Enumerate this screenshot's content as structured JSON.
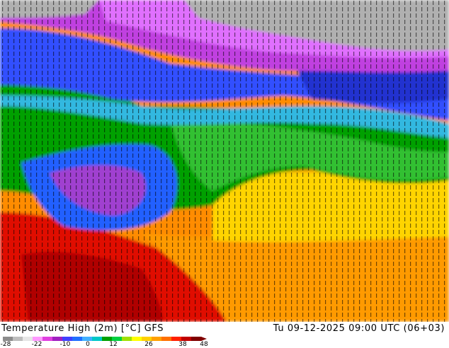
{
  "map": {
    "model": "GFS",
    "variable_title": "Temperature High (2m) [°C] GFS",
    "datetime": "Tu 09-12-2025 09:00 UTC (06+03)"
  },
  "legend": {
    "ticks": [
      "-28",
      "-22",
      "-10",
      "0",
      "12",
      "26",
      "38",
      "48"
    ],
    "colors": [
      "#8c8c8c",
      "#bdbdbd",
      "#e6e6e6",
      "#ff99ff",
      "#e040e0",
      "#a020c0",
      "#4040ff",
      "#2070ff",
      "#40b0ff",
      "#00c8c8",
      "#00a000",
      "#00d040",
      "#a0e000",
      "#ffff00",
      "#ffd000",
      "#ffa000",
      "#ff7000",
      "#ff2000",
      "#c00000",
      "#800000"
    ]
  }
}
